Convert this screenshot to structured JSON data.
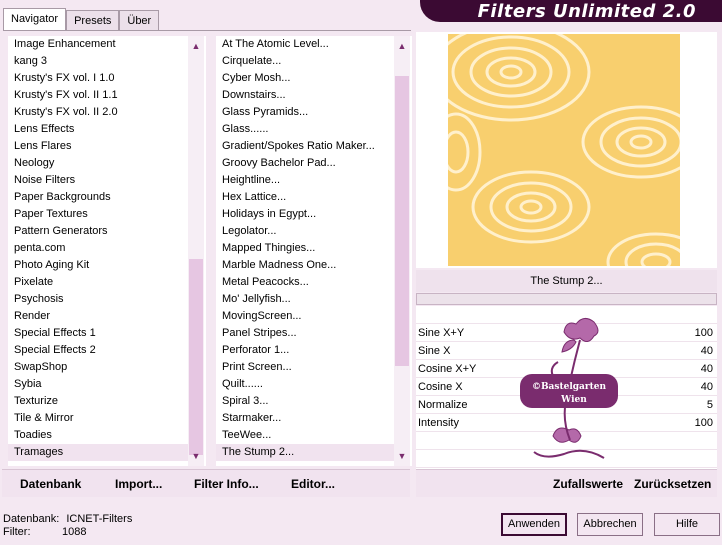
{
  "tabs": [
    "Navigator",
    "Presets",
    "Über"
  ],
  "brand_title": "Filters Unlimited 2.0",
  "categories": [
    "Image Enhancement",
    "kang 3",
    "Krusty's FX vol. I 1.0",
    "Krusty's FX vol. II 1.1",
    "Krusty's FX vol. II 2.0",
    "Lens Effects",
    "Lens Flares",
    "Neology",
    "Noise Filters",
    "Paper Backgrounds",
    "Paper Textures",
    "Pattern Generators",
    "penta.com",
    "Photo Aging Kit",
    "Pixelate",
    "Psychosis",
    "Render",
    "Special Effects 1",
    "Special Effects 2",
    "SwapShop",
    "Sybia",
    "Texturize",
    "Tile & Mirror",
    "Toadies",
    "Tramages"
  ],
  "selected_category": "Tramages",
  "filters": [
    "At The Atomic Level...",
    "Cirquelate...",
    "Cyber Mosh...",
    "Downstairs...",
    "Glass Pyramids...",
    "Glass......",
    "Gradient/Spokes Ratio Maker...",
    "Groovy Bachelor Pad...",
    "Heightline...",
    "Hex Lattice...",
    "Holidays in Egypt...",
    "Legolator...",
    "Mapped Thingies...",
    "Marble Madness One...",
    "Metal Peacocks...",
    "Mo' Jellyfish...",
    "MovingScreen...",
    "Panel Stripes...",
    "Perforator 1...",
    "Print Screen...",
    "Quilt......",
    "Spiral 3...",
    "Starmaker...",
    "TeeWee...",
    "The Stump 2..."
  ],
  "selected_filter": "The Stump 2...",
  "left_bar": {
    "db": "Datenbank",
    "import": "Import...",
    "filter_info": "Filter Info...",
    "editor": "Editor..."
  },
  "current_filter_title": "The Stump 2...",
  "params": [
    {
      "name": "Sine X+Y",
      "value": "100"
    },
    {
      "name": "Sine X",
      "value": "40"
    },
    {
      "name": "Cosine X+Y",
      "value": "40"
    },
    {
      "name": "Cosine X",
      "value": "40"
    },
    {
      "name": "Normalize",
      "value": "5"
    },
    {
      "name": "Intensity",
      "value": "100"
    }
  ],
  "right_bar": {
    "random": "Zufallswerte",
    "reset": "Zurücksetzen"
  },
  "watermark": {
    "line1": "©Bastelgarten",
    "line2": "Wien"
  },
  "status": {
    "db_label": "Datenbank:",
    "db_value": "ICNET-Filters",
    "filter_label": "Filter:",
    "filter_value": "1088"
  },
  "buttons": {
    "apply": "Anwenden",
    "cancel": "Abbrechen",
    "help": "Hilfe"
  },
  "colors": {
    "accent": "#3b0a33",
    "preview_base": "#f8cf6e",
    "preview_light": "#fff0cc"
  }
}
